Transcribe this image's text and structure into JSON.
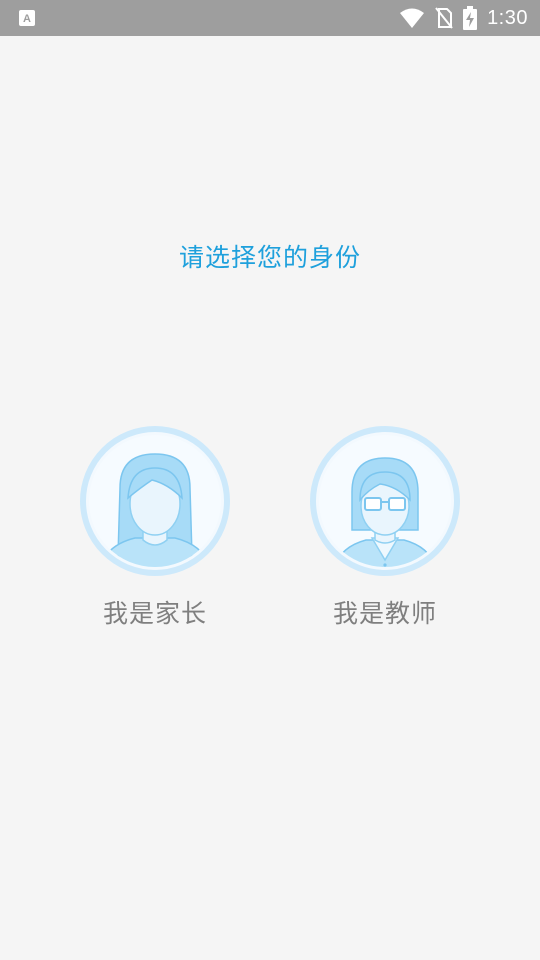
{
  "status_bar": {
    "time": "1:30",
    "icons": [
      "notification-a-icon",
      "wifi-icon",
      "no-sim-icon",
      "battery-charging-icon"
    ]
  },
  "page": {
    "title": "请选择您的身份"
  },
  "roles": {
    "parent": {
      "label": "我是家长",
      "icon": "parent-avatar-icon"
    },
    "teacher": {
      "label": "我是教师",
      "icon": "teacher-avatar-icon"
    }
  },
  "colors": {
    "title": "#1ea0dc",
    "label": "#7f7f7f",
    "status_bar": "#9e9e9e",
    "background": "#f5f5f5",
    "avatar_ring": "#cde9fb",
    "avatar_fill": "#a7dbf7"
  }
}
